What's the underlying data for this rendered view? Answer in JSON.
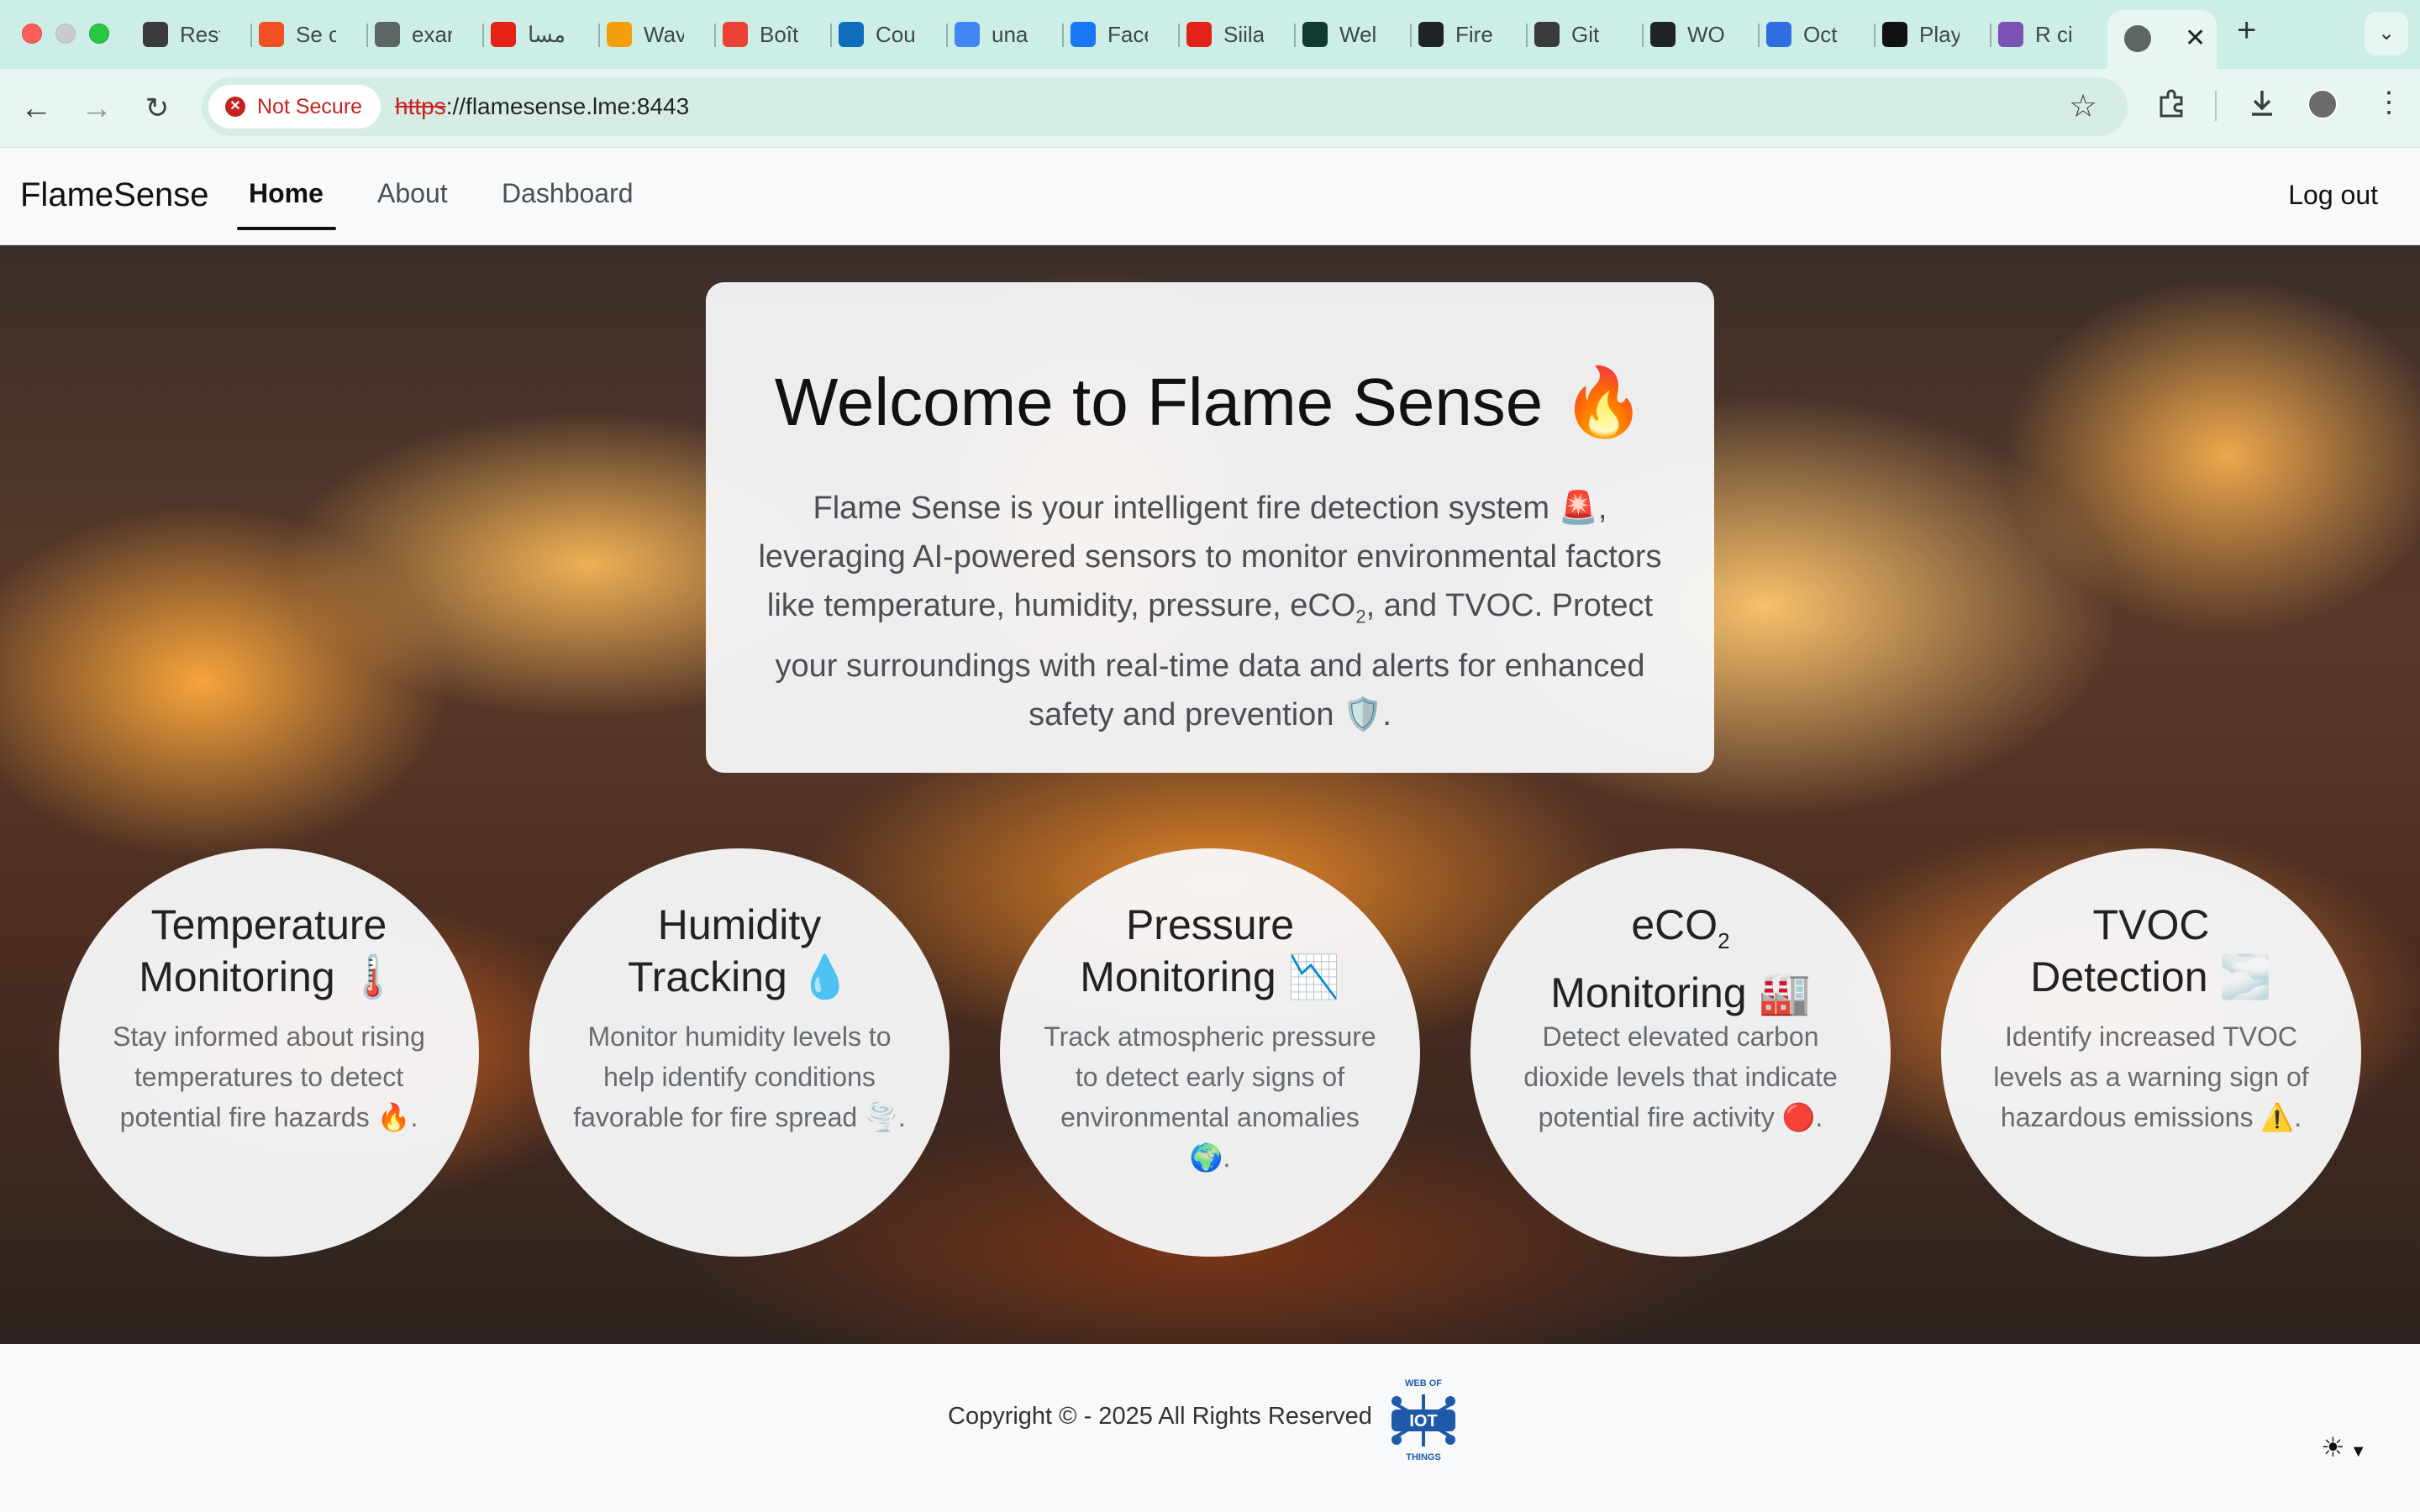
{
  "browser": {
    "tabs": [
      {
        "label": "Rest",
        "icon": "spiral-icon",
        "color": "#3a3a3a"
      },
      {
        "label": "Se c",
        "icon": "microsoft-icon",
        "color": "#f25022"
      },
      {
        "label": "exar",
        "icon": "globe-icon",
        "color": "#5d6664"
      },
      {
        "label": "مسا",
        "icon": "youtube-icon",
        "color": "#e62117"
      },
      {
        "label": "Wav",
        "icon": "coursera-icon",
        "color": "#f59e0b"
      },
      {
        "label": "Boît",
        "icon": "gmail-icon",
        "color": "#ea4335"
      },
      {
        "label": "Cou",
        "icon": "outlook-icon",
        "color": "#0f6cbd"
      },
      {
        "label": "una",
        "icon": "google-icon",
        "color": "#4285f4"
      },
      {
        "label": "Face",
        "icon": "facebook-icon",
        "color": "#1877f2"
      },
      {
        "label": "Siila",
        "icon": "youtube-icon",
        "color": "#e62117"
      },
      {
        "label": "Wel",
        "icon": "mongodb-icon",
        "color": "#0d3b2e"
      },
      {
        "label": "Fire",
        "icon": "github-icon",
        "color": "#1f2328"
      },
      {
        "label": "Git",
        "icon": "openai-icon",
        "color": "#3a3a3a"
      },
      {
        "label": "WO",
        "icon": "github-icon",
        "color": "#1f2328"
      },
      {
        "label": "Oct",
        "icon": "copilot-icon",
        "color": "#2f6de1"
      },
      {
        "label": "Play",
        "icon": "m-logo-icon",
        "color": "#111111"
      },
      {
        "label": "R ci",
        "icon": "bootstrap-icon",
        "color": "#7952b3"
      }
    ],
    "security_label": "Not Secure",
    "url_scheme": "https",
    "url_rest": "://flamesense.lme:8443"
  },
  "nav": {
    "brand": "FlameSense",
    "home": "Home",
    "about": "About",
    "dashboard": "Dashboard",
    "logout": "Log out"
  },
  "hero": {
    "title": "Welcome to Flame Sense 🔥",
    "desc_part1": "Flame Sense is your intelligent fire detection system 🚨, leveraging AI-powered sensors to monitor environmental factors like temperature, humidity, pressure, eCO",
    "desc_sub": "2",
    "desc_part2": ", and TVOC. Protect your surroundings with real-time data and alerts for enhanced safety and prevention 🛡️."
  },
  "features": [
    {
      "title_a": "Temperature",
      "title_b": "Monitoring 🌡️",
      "desc": "Stay informed about rising temperatures to detect potential fire hazards 🔥."
    },
    {
      "title_a": "Humidity",
      "title_b": "Tracking 💧",
      "desc": "Monitor humidity levels to help identify conditions favorable for fire spread 🌪️."
    },
    {
      "title_a": "Pressure",
      "title_b": "Monitoring 📉",
      "desc": "Track atmospheric pressure to detect early signs of environmental anomalies 🌍."
    },
    {
      "title_a": "eCO",
      "title_sub": "2",
      "title_b": "Monitoring 🏭",
      "desc": "Detect elevated carbon dioxide levels that indicate potential fire activity 🔴."
    },
    {
      "title_a": "TVOC",
      "title_b": "Detection 🌫️",
      "desc": "Identify increased TVOC levels as a warning sign of hazardous emissions ⚠️."
    }
  ],
  "footer": {
    "copyright": "Copyright ©  - 2025 All Rights Reserved",
    "logo_top": "WEB OF",
    "logo_mid": "IOT",
    "logo_bottom": "THINGS",
    "theme_icon": "sun-icon"
  },
  "colors": {
    "tabstrip": "#cdeee6",
    "toolbar": "#e8f6f2",
    "insecure_red": "#c5221f",
    "logo_blue": "#1e5aa8"
  }
}
